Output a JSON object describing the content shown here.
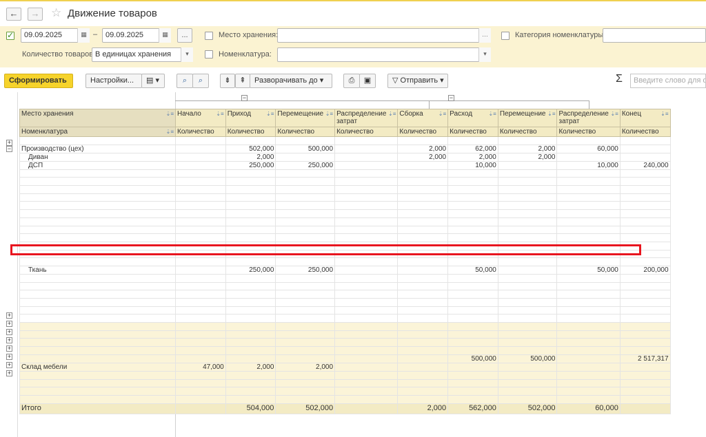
{
  "window": {
    "title": "Движение товаров",
    "back_icon": "←",
    "forward_icon": "→",
    "star_icon": "☆"
  },
  "filters": {
    "period_enabled": true,
    "date_from": "09.09.2025",
    "date_to": "09.09.2025",
    "dash": "–",
    "more_label": "...",
    "storage_label": "Место хранения:",
    "storage_value": "",
    "category_label": "Категория номенклатуры:",
    "category_value": "",
    "qty_label": "Количество товаров:",
    "qty_value": "В единицах хранения",
    "nomenclature_label": "Номенклатура:",
    "nomenclature_value": ""
  },
  "toolbar": {
    "generate": "Сформировать",
    "settings": "Настройки...",
    "expand_to": "Разворачивать до",
    "send": "Отправить",
    "sigma": "Σ",
    "search_placeholder": "Введите слово для фи"
  },
  "table": {
    "header1": [
      "Место хранения",
      "Начало",
      "Приход",
      "Перемещение",
      "Распределение затрат",
      "Сборка",
      "Расход",
      "Перемещение",
      "Распределение затрат",
      "Конец"
    ],
    "header2": [
      "Номенклатура",
      "Количество",
      "Количество",
      "Количество",
      "Количество",
      "Количество",
      "Количество",
      "Количество",
      "Количество",
      "Количество"
    ],
    "rows": [
      {
        "name": "",
        "v": [
          "",
          "",
          "",
          "",
          "",
          "",
          "",
          "",
          ""
        ],
        "band": false
      },
      {
        "name": "Производство (цех)",
        "v": [
          "",
          "502,000",
          "500,000",
          "",
          "2,000",
          "62,000",
          "2,000",
          "60,000",
          ""
        ],
        "band": false
      },
      {
        "name": "Диван",
        "indent": true,
        "v": [
          "",
          "2,000",
          "",
          "",
          "2,000",
          "2,000",
          "2,000",
          "",
          ""
        ],
        "band": false
      },
      {
        "name": "ДСП",
        "indent": true,
        "v": [
          "",
          "250,000",
          "250,000",
          "",
          "",
          "10,000",
          "",
          "10,000",
          "240,000"
        ],
        "band": false
      },
      {
        "name": "",
        "v": [
          "",
          "",
          "",
          "",
          "",
          "",
          "",
          "",
          ""
        ]
      },
      {
        "name": "",
        "v": [
          "",
          "",
          "",
          "",
          "",
          "",
          "",
          "",
          ""
        ]
      },
      {
        "name": "",
        "v": [
          "",
          "",
          "",
          "",
          "",
          "",
          "",
          "",
          ""
        ]
      },
      {
        "name": "",
        "v": [
          "",
          "",
          "",
          "",
          "",
          "",
          "",
          "",
          ""
        ]
      },
      {
        "name": "",
        "v": [
          "",
          "",
          "",
          "",
          "",
          "",
          "",
          "",
          ""
        ]
      },
      {
        "name": "",
        "v": [
          "",
          "",
          "",
          "",
          "",
          "",
          "",
          "",
          ""
        ]
      },
      {
        "name": "",
        "v": [
          "",
          "",
          "",
          "",
          "",
          "",
          "",
          "",
          ""
        ]
      },
      {
        "name": "",
        "v": [
          "",
          "",
          "",
          "",
          "",
          "",
          "",
          "",
          ""
        ]
      },
      {
        "name": "",
        "v": [
          "",
          "",
          "",
          "",
          "",
          "",
          "",
          "",
          ""
        ]
      },
      {
        "name": "",
        "v": [
          "",
          "",
          "",
          "",
          "",
          "",
          "",
          "",
          ""
        ]
      },
      {
        "name": "",
        "v": [
          "",
          "",
          "",
          "",
          "",
          "",
          "",
          "",
          ""
        ]
      },
      {
        "name": "",
        "v": [
          "",
          "",
          "",
          "",
          "",
          "",
          "",
          "",
          ""
        ]
      },
      {
        "name": "Ткань",
        "indent": true,
        "v": [
          "",
          "250,000",
          "250,000",
          "",
          "",
          "50,000",
          "",
          "50,000",
          "200,000"
        ]
      },
      {
        "name": "",
        "v": [
          "",
          "",
          "",
          "",
          "",
          "",
          "",
          "",
          ""
        ]
      },
      {
        "name": "",
        "v": [
          "",
          "",
          "",
          "",
          "",
          "",
          "",
          "",
          ""
        ]
      },
      {
        "name": "",
        "v": [
          "",
          "",
          "",
          "",
          "",
          "",
          "",
          "",
          ""
        ]
      },
      {
        "name": "",
        "v": [
          "",
          "",
          "",
          "",
          "",
          "",
          "",
          "",
          ""
        ]
      },
      {
        "name": "",
        "v": [
          "",
          "",
          "",
          "",
          "",
          "",
          "",
          "",
          ""
        ]
      },
      {
        "name": "",
        "v": [
          "",
          "",
          "",
          "",
          "",
          "",
          "",
          "",
          ""
        ]
      },
      {
        "name": "",
        "v": [
          "",
          "",
          "",
          "",
          "",
          "",
          "",
          "",
          ""
        ],
        "band": true
      },
      {
        "name": "",
        "v": [
          "",
          "",
          "",
          "",
          "",
          "",
          "",
          "",
          ""
        ],
        "band": true
      },
      {
        "name": "",
        "v": [
          "",
          "",
          "",
          "",
          "",
          "",
          "",
          "",
          ""
        ],
        "band": true
      },
      {
        "name": "",
        "v": [
          "",
          "",
          "",
          "",
          "",
          "",
          "",
          "",
          ""
        ],
        "band": true
      },
      {
        "name": "",
        "v": [
          "",
          "",
          "",
          "",
          "",
          "500,000",
          "500,000",
          "",
          "2 517,317"
        ],
        "band": true
      },
      {
        "name": "Склад мебели",
        "v": [
          "47,000",
          "2,000",
          "2,000",
          "",
          "",
          "",
          "",
          "",
          ""
        ],
        "band": true
      },
      {
        "name": "",
        "v": [
          "",
          "",
          "",
          "",
          "",
          "",
          "",
          "",
          ""
        ],
        "band": true
      },
      {
        "name": "",
        "v": [
          "",
          "",
          "",
          "",
          "",
          "",
          "",
          "",
          ""
        ],
        "band": true
      },
      {
        "name": "",
        "v": [
          "",
          "",
          "",
          "",
          "",
          "",
          "",
          "",
          ""
        ],
        "band": true
      },
      {
        "name": "",
        "v": [
          "",
          "",
          "",
          "",
          "",
          "",
          "",
          "",
          ""
        ],
        "band": true
      }
    ],
    "total": {
      "name": "Итого",
      "v": [
        "",
        "504,000",
        "502,000",
        "",
        "2,000",
        "562,000",
        "502,000",
        "60,000",
        ""
      ]
    }
  }
}
